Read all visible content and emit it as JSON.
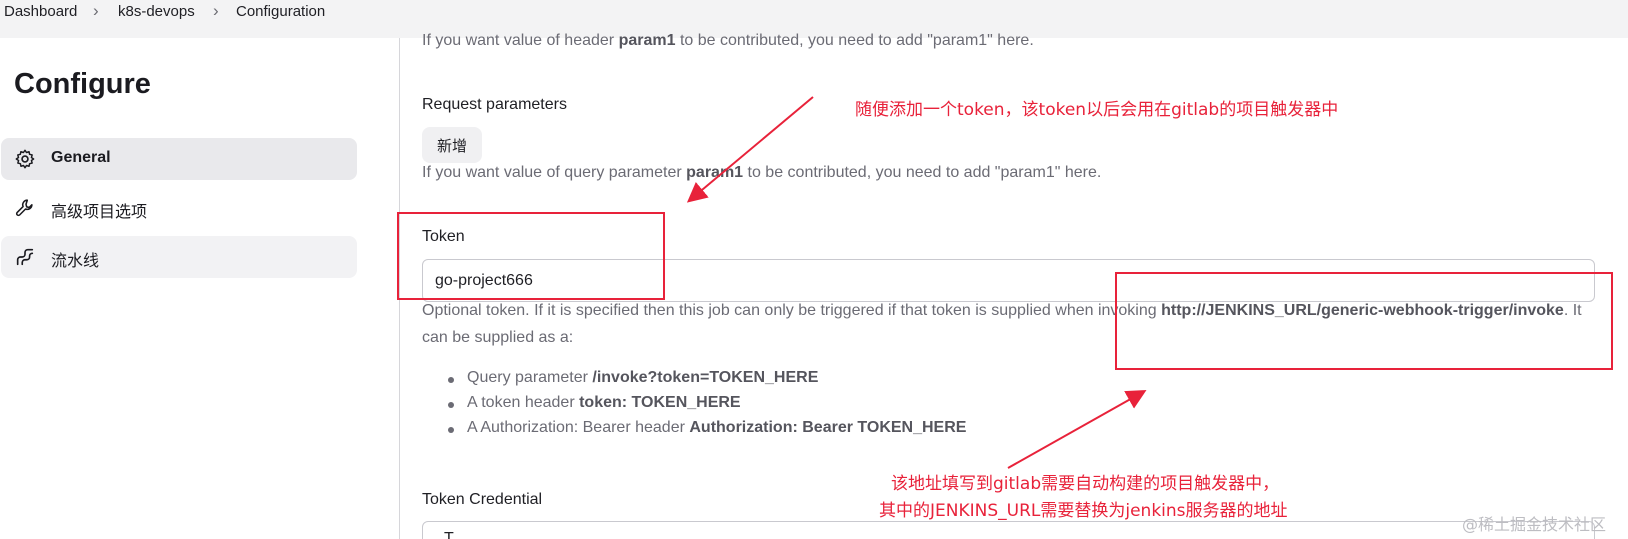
{
  "breadcrumb": [
    "Dashboard",
    "k8s-devops",
    "Configuration"
  ],
  "sidebar": {
    "title": "Configure",
    "items": [
      {
        "label": "General",
        "icon": "gear-icon",
        "active": true
      },
      {
        "label": "高级项目选项",
        "icon": "wrench-icon",
        "active": false
      },
      {
        "label": "流水线",
        "icon": "pipeline-icon",
        "active": false
      }
    ]
  },
  "main": {
    "header_help_prefix": "If you want value of header ",
    "header_help_param": "param1",
    "header_help_suffix": " to be contributed, you need to add \"param1\" here.",
    "request_params_label": "Request parameters",
    "add_button_label": "新增",
    "query_help_prefix": "If you want value of query parameter ",
    "query_help_param": "param1",
    "query_help_suffix": " to be contributed, you need to add \"param1\" here.",
    "token_label": "Token",
    "token_value": "go-project666",
    "token_help_prefix": "Optional token. If it is specified then this job can only be triggered if that token is supplied when invoking ",
    "token_help_url": "http://JENKINS_URL/generic-webhook-trigger/invoke",
    "token_help_suffix": ". It",
    "token_help_line2": "can be supplied as a:",
    "bullets": [
      {
        "prefix": "Query parameter ",
        "bold": "/invoke?token=TOKEN_HERE"
      },
      {
        "prefix": "A token header ",
        "bold": "token: TOKEN_HERE"
      },
      {
        "prefix": "A Authorization: Bearer header ",
        "bold": "Authorization: Bearer TOKEN_HERE"
      }
    ],
    "token_credential_label": "Token Credential",
    "token_credential_value": "T"
  },
  "annotations": {
    "note_top": "随便添加一个token，该token以后会用在gitlab的项目触发器中",
    "note_bottom_line1": "该地址填写到gitlab需要自动构建的项目触发器中，",
    "note_bottom_line2": "其中的JENKINS_URL需要替换为jenkins服务器的地址",
    "color": "#e8223a"
  },
  "watermark": "@稀土掘金技术社区"
}
